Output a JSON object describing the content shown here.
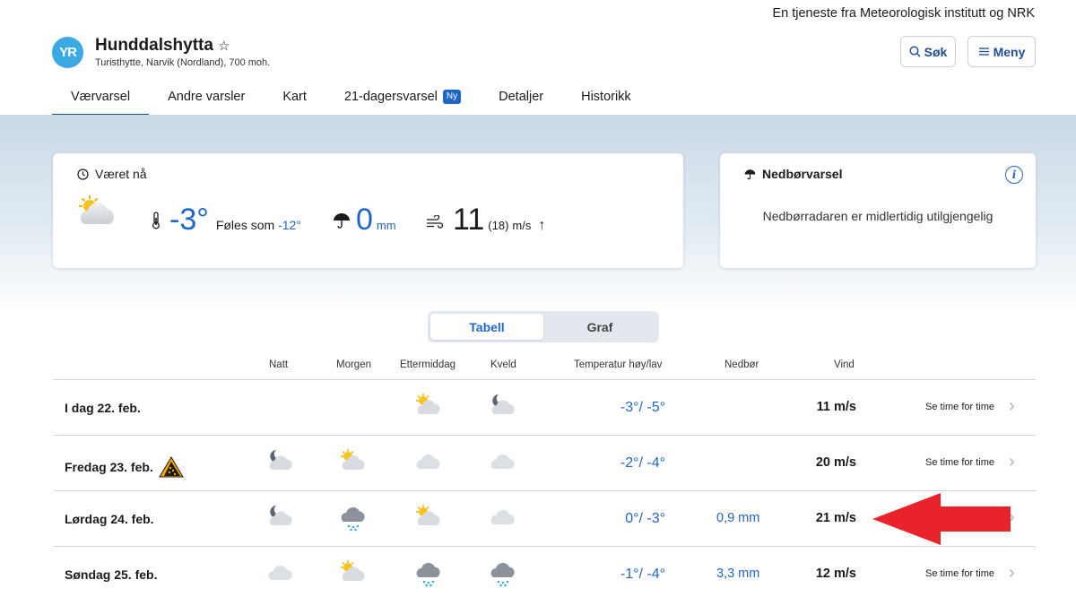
{
  "header": {
    "service_text": "En tjeneste fra Meteorologisk institutt og NRK",
    "logo_text": "YR",
    "location_name": "Hunddalshytta",
    "location_sub": "Turisthytte, Narvik (Nordland), 700 moh.",
    "search_label": "Søk",
    "menu_label": "Meny"
  },
  "nav": {
    "tabs": [
      {
        "label": "Værvarsel",
        "active": true
      },
      {
        "label": "Andre varsler"
      },
      {
        "label": "Kart"
      },
      {
        "label": "21-dagersvarsel",
        "badge": "Ny"
      },
      {
        "label": "Detaljer"
      },
      {
        "label": "Historikk"
      }
    ]
  },
  "now": {
    "title": "Været nå",
    "temp": "-3°",
    "feels_label": "Føles som",
    "feels_value": "-12°",
    "precip": "0",
    "precip_unit": "mm",
    "wind": "11",
    "gust": "(18)",
    "wind_unit": "m/s",
    "wind_arrow": "↑"
  },
  "precip_card": {
    "title": "Nedbørvarsel",
    "info": "i",
    "message": "Nedbørradaren er midlertidig utilgjengelig"
  },
  "toggle": {
    "table_label": "Tabell",
    "graph_label": "Graf"
  },
  "table": {
    "headers": {
      "night": "Natt",
      "morning": "Morgen",
      "afternoon": "Ettermiddag",
      "evening": "Kveld",
      "temp": "Temperatur høy/lav",
      "precip": "Nedbør",
      "wind": "Vind"
    },
    "hourly_link": "Se time for time",
    "rows": [
      {
        "day": "I dag 22. feb.",
        "icons": [
          "",
          "",
          "partly-sunny-icon",
          "partly-night-icon"
        ],
        "temp": "-3°/ -5°",
        "precip": "",
        "wind": "11 m/s",
        "warning": false
      },
      {
        "day": "Fredag 23. feb.",
        "icons": [
          "partly-night-icon",
          "partly-sunny-icon",
          "cloud-icon",
          "cloud-icon"
        ],
        "temp": "-2°/ -4°",
        "precip": "",
        "wind": "20 m/s",
        "warning": true
      },
      {
        "day": "Lørdag 24. feb.",
        "icons": [
          "partly-night-icon",
          "snow-cloud-icon",
          "partly-sunny-icon",
          "cloud-icon"
        ],
        "temp": "0°/ -3°",
        "precip": "0,9 mm",
        "wind": "21 m/s",
        "warning": false
      },
      {
        "day": "Søndag 25. feb.",
        "icons": [
          "cloud-icon",
          "partly-sunny-icon",
          "snow-cloud-icon",
          "snow-cloud-icon"
        ],
        "temp": "-1°/ -4°",
        "precip": "3,3 mm",
        "wind": "12 m/s",
        "warning": false
      }
    ]
  },
  "colors": {
    "accent": "#1f66c7",
    "nav_active": "#1f4e93",
    "annotation_arrow": "#e8232a"
  }
}
